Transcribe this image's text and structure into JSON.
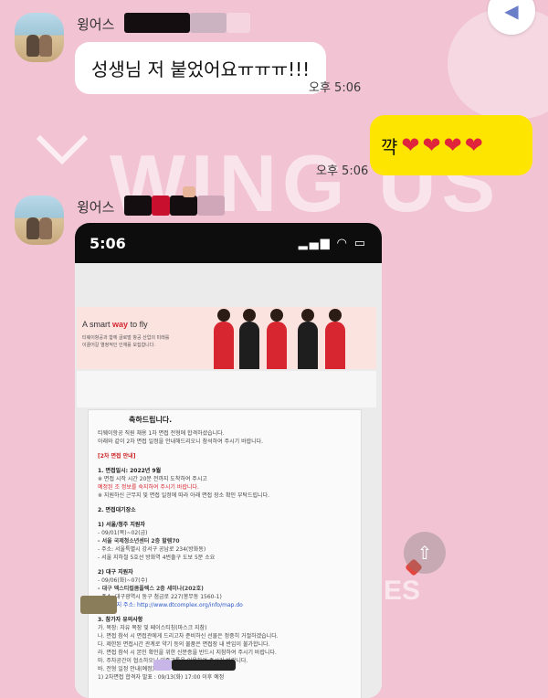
{
  "background": {
    "watermark": "WING US",
    "corner_text": "ES"
  },
  "chat": {
    "sender_name": "윙어스",
    "messages": [
      {
        "from": "other",
        "text": "성생님 저 붙었어요ㅠㅠㅠ!!!",
        "time": "오후 5:06"
      },
      {
        "from": "me",
        "text": "꺅",
        "time": "오후 5:06"
      },
      {
        "from": "other",
        "type": "image",
        "time": ""
      }
    ]
  },
  "screenshot": {
    "status_time": "5:06",
    "status_icons": "▂▄▆ ◠ ▭",
    "banner_slogan_a": "A smart",
    "banner_slogan_b": "way",
    "banner_slogan_c": "to fly",
    "banner_sub": "티웨이항공과 함께 글로벌 항공 산업의 미래를 이끌어갈 열정적인 인재를 모집합니다.",
    "doc_title": "축하드립니다.",
    "doc_intro_1": "티웨이항공 직원 채용 1차 면접 전형에 합격하셨습니다.",
    "doc_intro_2": "아래와 같이 2차 면접 일정을 안내해드리오니 참석하여 주시기 바랍니다.",
    "sec_notice": "[2차 면접 안내]",
    "sec_1": "1. 면접일시: 2022년 9월",
    "sec_1_a": "※ 면접 시작 시간 20분 전까지 도착하여 주시고",
    "sec_1_b": "예정된 조 정보를 숙지하여 주시기 바랍니다.",
    "sec_1_c": "※ 지원하신 근무지 및 면접 일정에 따라 아래 면접 장소 확인 부탁드립니다.",
    "sec_2": "2. 면접대기장소",
    "sec_2_1": "1) 서울/청주 지원자",
    "sec_2_1_a": "- 09/01(목)~02(금)",
    "sec_2_1_b": "- 서울 국제청소년센터 2층 할렘70",
    "sec_2_1_c": "- 주소: 서울특별시 강서구 공남로 234(방화동)",
    "sec_2_1_d": "- 서울 지하철 5호선 방화역 4번출구 도보 5분 소요",
    "sec_2_2": "2) 대구 지원자",
    "sec_2_2_a": "- 09/06(화)~07(수)",
    "sec_2_2_b": "- 대구 엑스티컬콤플렉스 2층 세미나(202호)",
    "sec_2_2_c": "- 주소: 대구광역시 동구 첨금로 227(봉무동 1560-1)",
    "sec_2_2_d": "- 홈페이지 주소: http://www.dtcomplex.org/info/map.do",
    "sec_3": "3. 참가자 유의사항",
    "sec_3_a": "가. 복장: 자유 복장 및 페이스티칭(마스크 지참)",
    "sec_3_b": "나. 면접 참석 시 면접관에게 드리고자 준비하신 선물은 정중히 거절하겠습니다.",
    "sec_3_c": "다. 제한된 면접시간 관계로 약기 등의 물품은 면접장 내 반입이 불가합니다.",
    "sec_3_d": "라. 면접 참석 시 본인 확인을 위한 신분증을 반드시 지참하여 주시기 바랍니다.",
    "sec_3_e": "마. 주차공간이 협소하오니 대중교통을 이용하여 주시기 바랍니다.",
    "sec_3_f": "바. 전형 일정 안내(예정)",
    "sec_3_g": "1) 2차면접 합격자 발표 : 09/13(화) 17:00 이후 예정"
  },
  "colors": {
    "chat_bg": "#f2c4d3",
    "my_bubble": "#fde500",
    "brand_red": "#d7262f"
  }
}
